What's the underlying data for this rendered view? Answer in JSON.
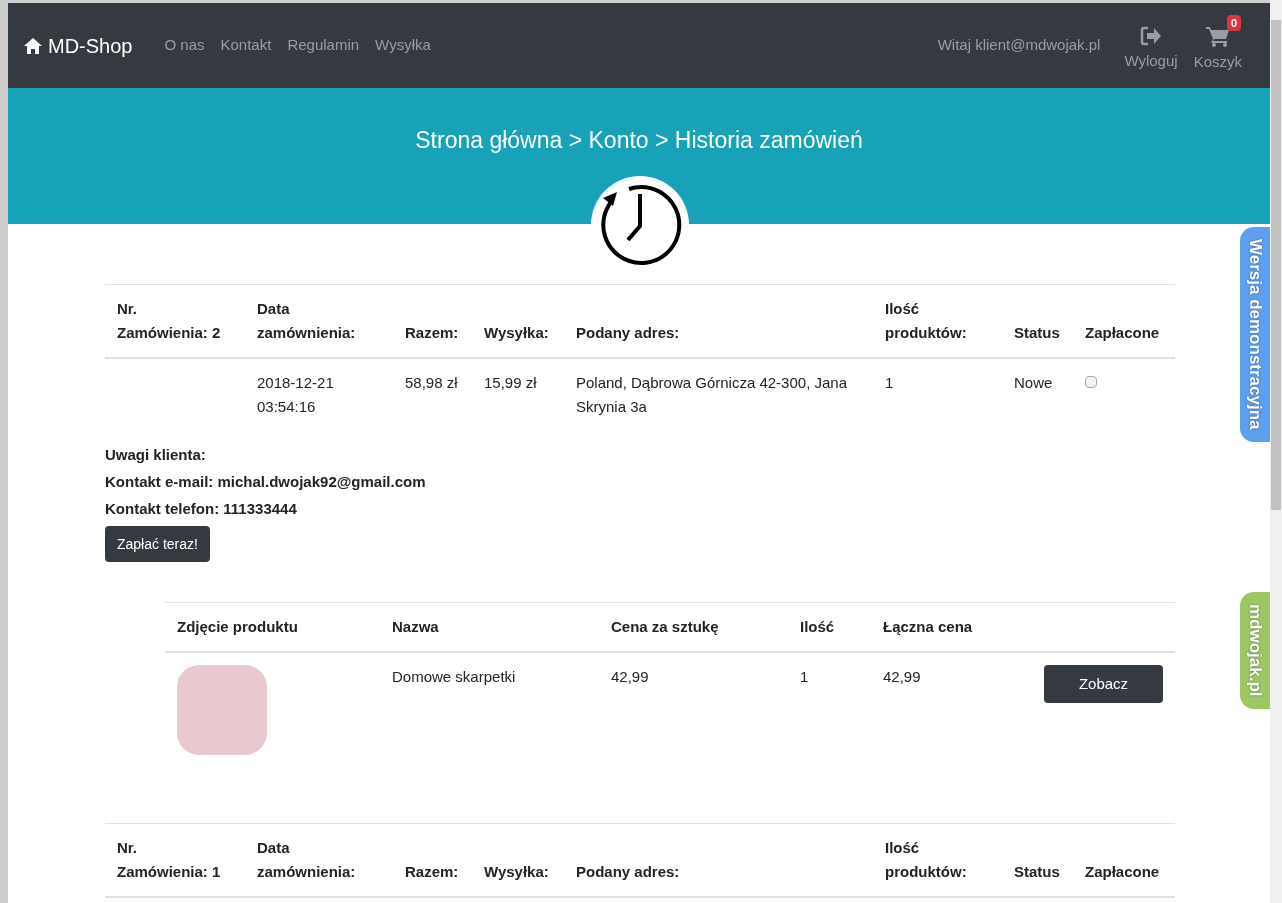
{
  "navbar": {
    "brand": "MD-Shop",
    "links": [
      "O nas",
      "Kontakt",
      "Regulamin",
      "Wysyłka"
    ],
    "greeting": "Witaj klient@mdwojak.pl",
    "actions": [
      {
        "kind": "logout",
        "label": "Wyloguj"
      },
      {
        "kind": "cart",
        "label": "Koszyk",
        "badge": "0"
      }
    ]
  },
  "breadcrumb": "Strona główna > Konto > Historia zamówień",
  "orders": [
    {
      "columns": [
        "Nr. Zamówienia: 2",
        "Data zamównienia:",
        "Razem:",
        "Wysyłka:",
        "Podany adres:",
        "Ilość produktów:",
        "Status",
        "Zapłacone"
      ],
      "row": {
        "date": "2018-12-21 03:54:16",
        "total": "58,98 zł",
        "shipping": "15,99 zł",
        "address": "Poland, Dąbrowa Górnicza 42-300, Jana Skrynia 3a",
        "count": "1",
        "status": "Nowe",
        "paid": false
      },
      "notes": [
        "Uwagi klienta:",
        "Kontakt e-mail: michal.dwojak92@gmail.com",
        "Kontakt telefon: 111333444"
      ],
      "pay_button": "Zapłać teraz!",
      "products": {
        "columns": [
          "Zdjęcie produktu",
          "Nazwa",
          "Cena za sztukę",
          "Ilość",
          "Łączna cena"
        ],
        "rows": [
          {
            "name": "Domowe skarpetki",
            "price": "42,99",
            "qty": "1",
            "total": "42,99",
            "button": "Zobacz"
          }
        ]
      }
    },
    {
      "columns": [
        "Nr. Zamówienia: 1",
        "Data zamównienia:",
        "Razem:",
        "Wysyłka:",
        "Podany adres:",
        "Ilość produktów:",
        "Status",
        "Zapłacone"
      ]
    }
  ],
  "side_tabs": [
    {
      "label": "Wersja demonstracyjna",
      "color": "#5f9ff0"
    },
    {
      "label": "mdwojak.pl",
      "color": "#9cc764"
    }
  ]
}
